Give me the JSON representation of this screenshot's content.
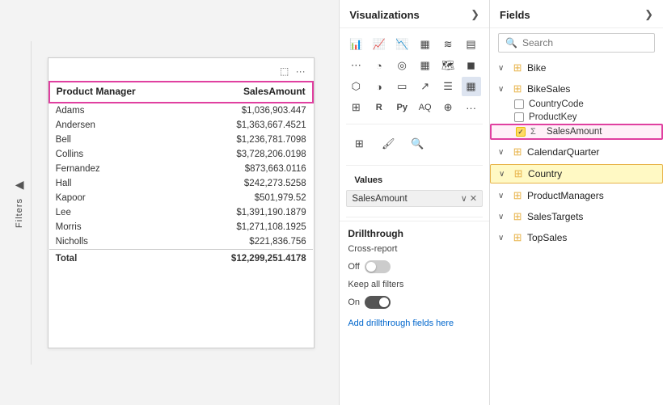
{
  "left": {
    "table": {
      "headers": [
        "Product Manager",
        "SalesAmount"
      ],
      "rows": [
        {
          "name": "Adams",
          "amount": "$1,036,903.447"
        },
        {
          "name": "Andersen",
          "amount": "$1,363,667.4521"
        },
        {
          "name": "Bell",
          "amount": "$1,236,781.7098"
        },
        {
          "name": "Collins",
          "amount": "$3,728,206.0198"
        },
        {
          "name": "Fernandez",
          "amount": "$873,663.0116"
        },
        {
          "name": "Hall",
          "amount": "$242,273.5258"
        },
        {
          "name": "Kapoor",
          "amount": "$501,979.52"
        },
        {
          "name": "Lee",
          "amount": "$1,391,190.1879"
        },
        {
          "name": "Morris",
          "amount": "$1,271,108.1925"
        },
        {
          "name": "Nicholls",
          "amount": "$221,836.756"
        }
      ],
      "total": {
        "label": "Total",
        "amount": "$12,299,251.4178"
      }
    }
  },
  "filters": {
    "label": "Filters"
  },
  "visualizations": {
    "title": "Visualizations",
    "arrow_left": "❮",
    "arrow_right": "❯",
    "values_label": "Values",
    "values_field": "SalesAmount",
    "drillthrough": {
      "title": "Drillthrough",
      "cross_report_label": "Cross-report",
      "cross_report_state": "Off",
      "keep_filters_label": "Keep all filters",
      "keep_filters_state": "On",
      "add_label": "Add drillthrough fields here"
    }
  },
  "fields": {
    "title": "Fields",
    "arrow": "❯",
    "search_placeholder": "Search",
    "groups": [
      {
        "id": "bike",
        "label": "Bike",
        "type": "table",
        "expanded": false,
        "items": []
      },
      {
        "id": "bikesales",
        "label": "BikeSales",
        "type": "table",
        "expanded": true,
        "items": [
          {
            "label": "CountryCode",
            "checked": false,
            "isMeasure": false
          },
          {
            "label": "ProductKey",
            "checked": false,
            "isMeasure": false
          },
          {
            "label": "SalesAmount",
            "checked": true,
            "isMeasure": true,
            "highlighted": true
          }
        ]
      },
      {
        "id": "calendarquarter",
        "label": "CalendarQuarter",
        "type": "table",
        "expanded": false,
        "items": []
      },
      {
        "id": "country",
        "label": "Country",
        "type": "table",
        "expanded": false,
        "items": [],
        "highlighted": true
      },
      {
        "id": "productmanagers",
        "label": "ProductManagers",
        "type": "table",
        "expanded": false,
        "items": []
      },
      {
        "id": "salestargets",
        "label": "SalesTargets",
        "type": "table",
        "expanded": false,
        "items": []
      },
      {
        "id": "topsales",
        "label": "TopSales",
        "type": "table",
        "expanded": false,
        "items": []
      }
    ]
  }
}
